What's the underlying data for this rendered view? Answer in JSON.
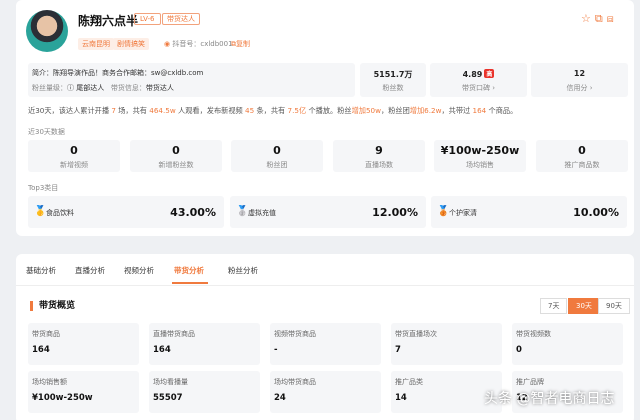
{
  "profile": {
    "name": "陈翔六点半",
    "level": "LV-6",
    "role_badge": "带货达人",
    "tags": [
      "云南昆明",
      "剧情搞笑"
    ],
    "douyin_label": "抖音号：cxldb001",
    "copy_label": "复制"
  },
  "intro": {
    "line1": "简介：陈翔导演作品！商务合作邮箱：sw@cxldb.com",
    "fan_level_label": "粉丝量级：",
    "fan_level_value": "尾部达人",
    "goods_label": "带货信息：",
    "goods_value": "带货达人"
  },
  "stats": [
    {
      "value": "5151.7万",
      "label": "粉丝数"
    },
    {
      "value": "4.89",
      "badge": "高",
      "label": "带货口碑"
    },
    {
      "value": "12",
      "label": "信用分"
    }
  ],
  "summary": {
    "p1": "近30天，该达人累计开播",
    "v1": "7",
    "p2": "场，共有",
    "v2": "464.5w",
    "p3": "人观看，发布新视频",
    "v3": "45",
    "p4": "条，共有",
    "v4": "7.5亿",
    "p5": "个播放。粉丝",
    "v5": "增加50w",
    "p6": "，粉丝团",
    "v6": "增加6.2w",
    "p7": "，共带过",
    "v7": "164",
    "p8": "个商品。"
  },
  "section30_label": "近30天数据",
  "kpis": [
    {
      "value": "0",
      "label": "新增视频"
    },
    {
      "value": "0",
      "label": "新增粉丝数"
    },
    {
      "value": "0",
      "label": "粉丝团"
    },
    {
      "value": "9",
      "label": "直播场数"
    },
    {
      "value": "¥100w-250w",
      "label": "场均销售"
    },
    {
      "value": "0",
      "label": "推广商品数"
    }
  ],
  "top3_label": "Top3类目",
  "categories": [
    {
      "name": "食品饮料",
      "pct": "43.00%"
    },
    {
      "name": "虚拟充值",
      "pct": "12.00%"
    },
    {
      "name": "个护家清",
      "pct": "10.00%"
    }
  ],
  "tabs": [
    "基础分析",
    "直播分析",
    "视频分析",
    "带货分析",
    "粉丝分析"
  ],
  "overview": {
    "title": "带货概览",
    "ranges": [
      "7天",
      "30天",
      "90天"
    ]
  },
  "metrics_row1": [
    {
      "label": "带货商品",
      "value": "164"
    },
    {
      "label": "直播带货商品",
      "value": "164"
    },
    {
      "label": "视频带货商品",
      "value": "-"
    },
    {
      "label": "带货直播场次",
      "value": "7"
    },
    {
      "label": "带货视频数",
      "value": "0"
    }
  ],
  "metrics_row2": [
    {
      "label": "场均销售额",
      "value": "¥100w-250w"
    },
    {
      "label": "场均看播量",
      "value": "55507"
    },
    {
      "label": "场均带货商品",
      "value": "24"
    },
    {
      "label": "推广品类",
      "value": "14"
    },
    {
      "label": "推广品牌",
      "value": "12"
    }
  ],
  "watermark": "头条 @智者电商日志"
}
